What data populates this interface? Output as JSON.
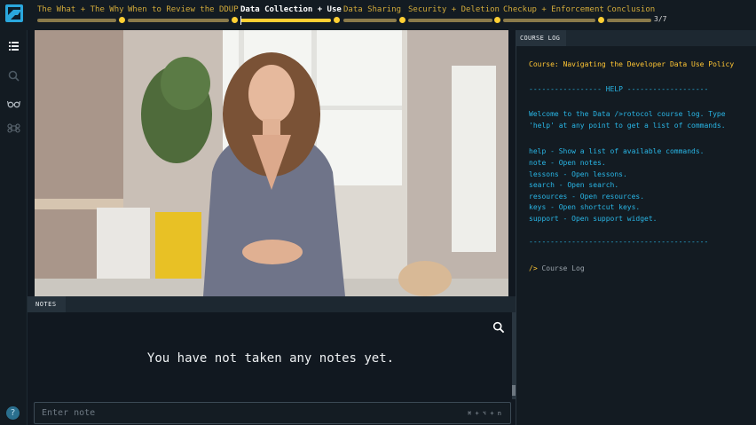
{
  "nav": {
    "sections": [
      {
        "label": "The What + The Why",
        "active": false
      },
      {
        "label": "When to Review the DDUP",
        "active": false
      },
      {
        "label": "Data Collection + Use",
        "active": true
      },
      {
        "label": "Data Sharing",
        "active": false
      },
      {
        "label": "Security + Deletion",
        "active": false
      },
      {
        "label": "Checkup + Enforcement",
        "active": false
      },
      {
        "label": "Conclusion",
        "active": false
      }
    ],
    "progress": "3/7"
  },
  "rail": {
    "icons": [
      "list-icon",
      "search-icon",
      "glasses-icon",
      "command-icon"
    ]
  },
  "notes": {
    "tab_label": "NOTES",
    "empty_message": "You have not taken any notes yet.",
    "input_placeholder": "Enter note",
    "input_shortcut": "⌘ + ⌥ + n"
  },
  "help_button": "?",
  "course_log": {
    "tab_label": "COURSE LOG",
    "course_line": "Course: Navigating the Developer Data Use Policy",
    "help_header": "----------------- HELP -------------------",
    "welcome_1": "Welcome to the Data />rotocol course log. Type",
    "welcome_2": "'help' at any point to get a list of commands.",
    "commands": [
      "help - Show a list of available commands.",
      "note - Open notes.",
      "lessons - Open lessons.",
      "search - Open search.",
      "resources - Open resources.",
      "keys - Open shortcut keys.",
      "support - Open support widget."
    ],
    "divider": "------------------------------------------",
    "prompt_symbol": "/>",
    "prompt_text": "Course Log"
  },
  "colors": {
    "accent_yellow": "#ffcf33",
    "log_cyan": "#29b6e6",
    "logo_blue": "#2aa7dd"
  }
}
